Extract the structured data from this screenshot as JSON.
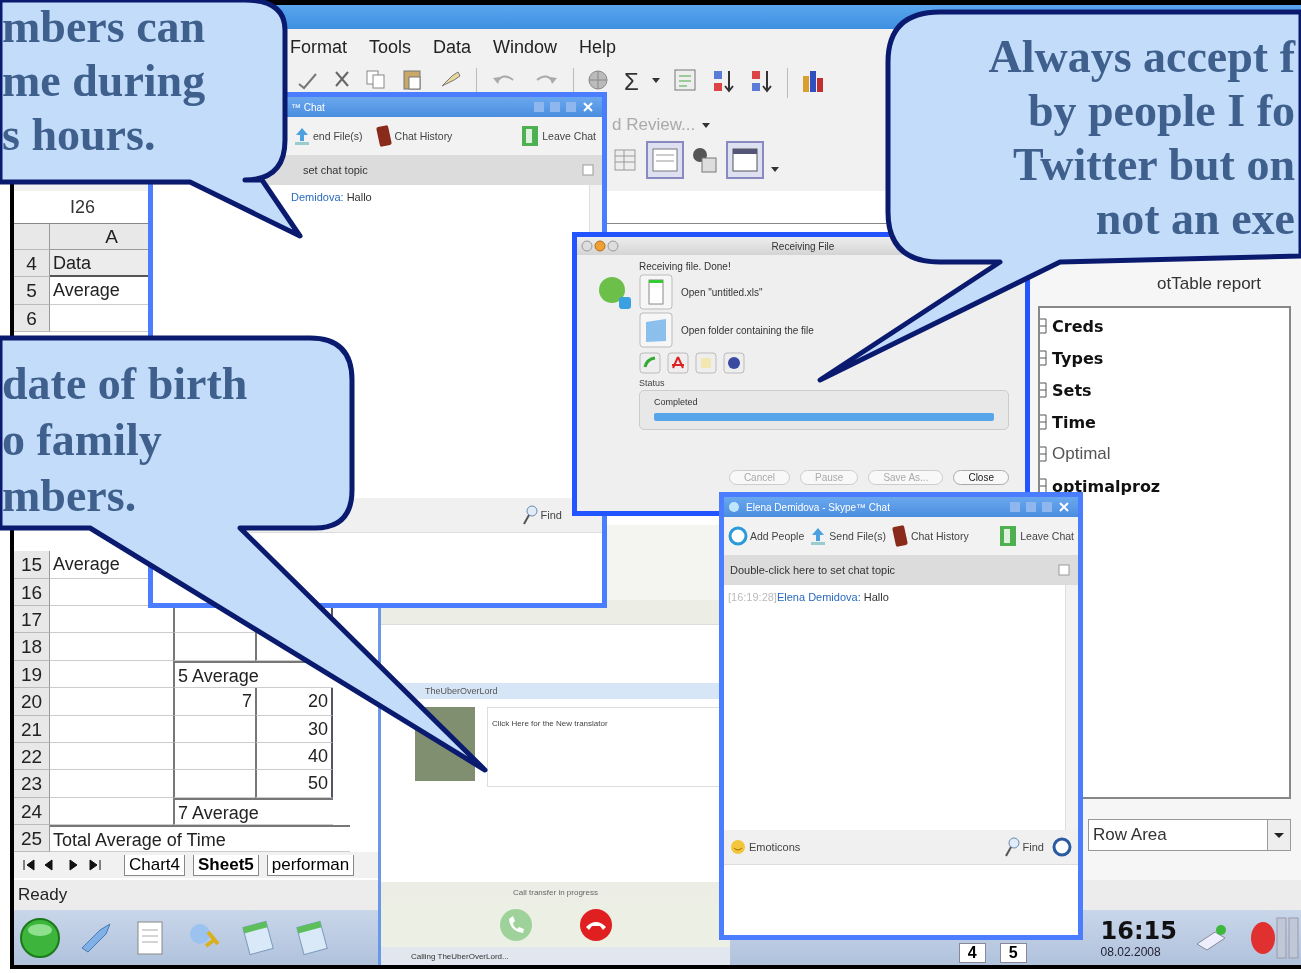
{
  "spreadsheet": {
    "menu": [
      "Format",
      "Tools",
      "Data",
      "Window",
      "Help"
    ],
    "autosum_symbol": "Σ",
    "review_label": "d Review...",
    "name_box": "I26",
    "column_header": "A",
    "rows_top": [
      {
        "number": "4",
        "a": "Data"
      },
      {
        "number": "5",
        "a": "Average"
      },
      {
        "number": "6"
      }
    ],
    "rows_bottom": [
      {
        "number": "15",
        "a": "Average"
      },
      {
        "number": "16"
      },
      {
        "number": "17"
      },
      {
        "number": "18"
      },
      {
        "number": "19",
        "b": "5 Average"
      },
      {
        "number": "20",
        "b": "7",
        "c": "20"
      },
      {
        "number": "21",
        "c": "30"
      },
      {
        "number": "22",
        "c": "40"
      },
      {
        "number": "23",
        "c": "50"
      },
      {
        "number": "24",
        "b": "7 Average"
      },
      {
        "number": "25",
        "a": "Total Average of Time"
      }
    ],
    "sheet_tabs": [
      {
        "label": "Chart4",
        "selected": false
      },
      {
        "label": "Sheet5",
        "selected": true
      },
      {
        "label": "performan",
        "selected": false
      }
    ],
    "status": "Ready"
  },
  "pivot_field_list": {
    "heading": "otTable report",
    "fields": [
      {
        "label": "Creds",
        "in_use": true
      },
      {
        "label": "Types",
        "in_use": true
      },
      {
        "label": "Sets",
        "in_use": true
      },
      {
        "label": "Time",
        "in_use": true
      },
      {
        "label": "Optimal",
        "in_use": false
      },
      {
        "label": "optimalproz",
        "in_use": true
      }
    ],
    "area": "Row Area"
  },
  "taskbar": {
    "task_buttons": [
      "4",
      "5"
    ],
    "time": "16:15",
    "date": "08.02.2008"
  },
  "skype_call_window": {
    "contact": "TheUberOverLord",
    "message": "Click Here for the New translator",
    "call_status": "Call transfer in progress",
    "status_bar": "Calling TheUberOverLord..."
  },
  "chat_windows": [
    {
      "title": "™ Chat",
      "tools": [
        {
          "kind": "send",
          "label": "end File(s)"
        },
        {
          "kind": "history",
          "label": "Chat History"
        },
        {
          "kind": "leave",
          "label": "Leave Chat"
        }
      ],
      "topic": "set chat topic",
      "messages": [
        {
          "sender": "Demidova:",
          "text": "Hallo"
        }
      ],
      "find_label": "Find"
    },
    {
      "title": "Elena Demidova - Skype™ Chat",
      "tools": [
        {
          "kind": "add",
          "label": "Add People"
        },
        {
          "kind": "send",
          "label": "Send File(s)"
        },
        {
          "kind": "history",
          "label": "Chat History"
        },
        {
          "kind": "leave",
          "label": "Leave Chat"
        }
      ],
      "topic": "Double-click here to set chat topic",
      "messages": [
        {
          "time": "[16:19:28]",
          "sender": "Elena Demidova:",
          "text": "Hallo"
        }
      ],
      "emoticons_label": "Emoticons",
      "find_label": "Find"
    }
  ],
  "receiving_file_dialog": {
    "title": "Receiving File",
    "message": "Receiving file. Done!",
    "actions": [
      {
        "kind": "file",
        "label": "Open \"untitled.xls\""
      },
      {
        "kind": "folder",
        "label": "Open folder containing the file"
      }
    ],
    "status_label": "Status",
    "status_text": "Completed",
    "level": 1,
    "buttons": [
      {
        "label": "Cancel",
        "disabled": true
      },
      {
        "label": "Pause",
        "disabled": true
      },
      {
        "label": "Save As...",
        "disabled": true
      },
      {
        "label": "Close",
        "disabled": false
      }
    ]
  },
  "callouts": [
    {
      "text": "mbers can\nme during\ns hours."
    },
    {
      "text": "Always accept f\nby people I fo\nTwitter but on\nnot an exe"
    },
    {
      "text": "date of birth\no family\nmbers."
    }
  ]
}
